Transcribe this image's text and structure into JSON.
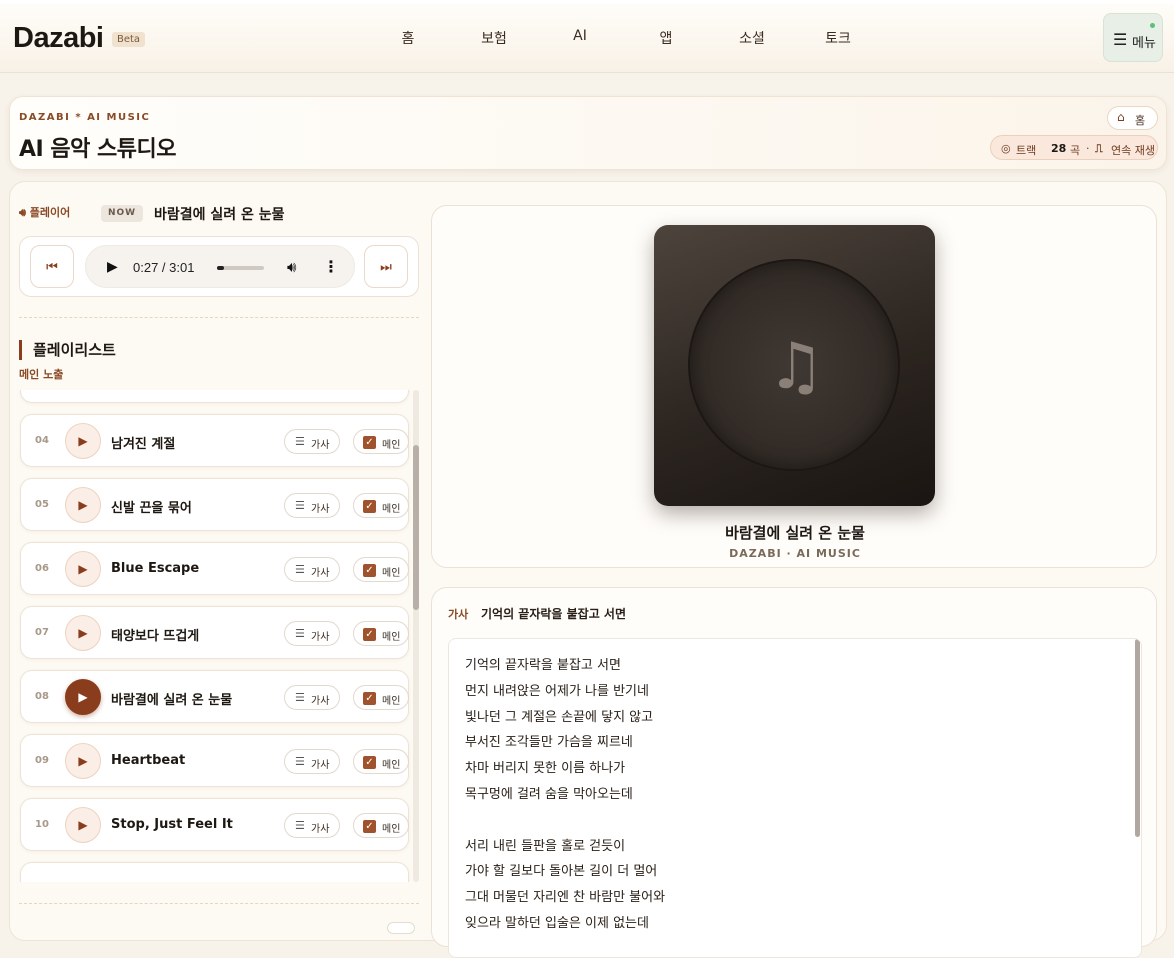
{
  "app": {
    "logo": "Dazabi",
    "badge": "Beta"
  },
  "nav": {
    "items": [
      "홈",
      "보험",
      "AI",
      "앱",
      "소셜",
      "토크"
    ],
    "menu_label": "메뉴"
  },
  "page": {
    "eyebrow": "DAZABI * AI MUSIC",
    "title": "AI 음악 스튜디오",
    "home_label": "홈",
    "track_label": "트랙",
    "track_count": "28",
    "track_unit": "곡",
    "autoplay_label": "연속 재생"
  },
  "player": {
    "label": "플레이어",
    "now_badge": "NOW",
    "now_title": "바람결에 실려 온 눈물",
    "time": "0:27 / 3:01",
    "progress": 0.149
  },
  "playlist": {
    "title": "플레이리스트",
    "subtitle": "메인 노출",
    "lyrics_btn": "가사",
    "main_btn": "메인",
    "tracks": [
      {
        "num": "04",
        "title": "남겨진 계절",
        "main": true,
        "active": false
      },
      {
        "num": "05",
        "title": "신발 끈을 묶어",
        "main": true,
        "active": false
      },
      {
        "num": "06",
        "title": "Blue Escape",
        "main": true,
        "active": false
      },
      {
        "num": "07",
        "title": "태양보다 뜨겁게",
        "main": true,
        "active": false
      },
      {
        "num": "08",
        "title": "바람결에 실려 온 눈물",
        "main": true,
        "active": true
      },
      {
        "num": "09",
        "title": "Heartbeat",
        "main": true,
        "active": false
      },
      {
        "num": "10",
        "title": "Stop, Just Feel It",
        "main": true,
        "active": false
      }
    ]
  },
  "artwork": {
    "title": "바람결에 실려 온 눈물",
    "subtitle": "DAZABI · AI MUSIC"
  },
  "lyrics": {
    "label": "가사",
    "first_line": "기억의 끝자락을 붙잡고 서면",
    "lines": [
      "기억의 끝자락을 붙잡고 서면",
      "먼지 내려앉은 어제가 나를 반기네",
      "빛나던 그 계절은 손끝에 닿지 않고",
      "부서진 조각들만 가슴을 찌르네",
      "차마 버리지 못한 이름 하나가",
      "목구멍에 걸려 숨을 막아오는데",
      "",
      "서리 내린 들판을 홀로 걷듯이",
      "가야 할 길보다 돌아본 길이 더 멀어",
      "그대 머물던 자리엔 찬 바람만 불어와",
      "잊으라 말하던 입술은 이제 없는데"
    ]
  }
}
